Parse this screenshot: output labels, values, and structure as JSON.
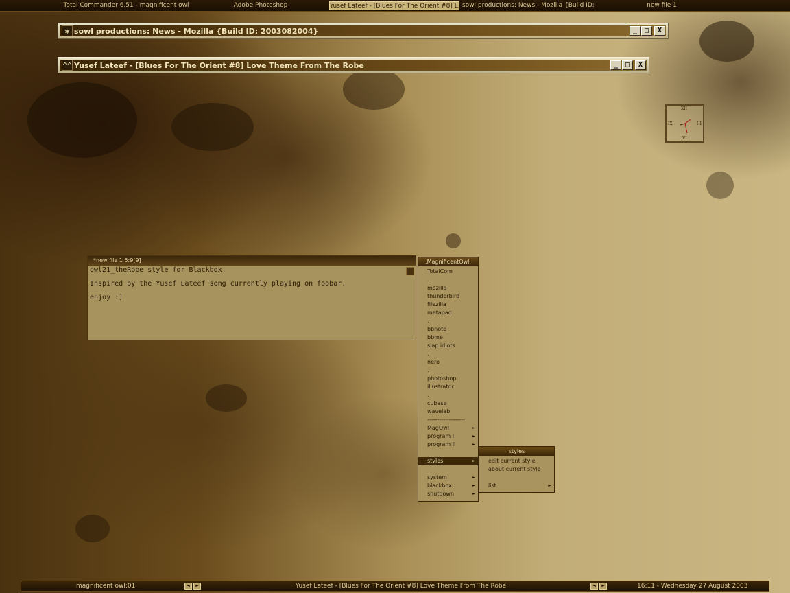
{
  "taskbar": {
    "tasks": [
      "Total Commander 6.51 - magnificent owl",
      "Adobe Photoshop",
      "Yusef Lateef - [Blues For The Orient #8] L...",
      "sowl productions: News - Mozilla {Build ID:...",
      "new file 1"
    ]
  },
  "windows": {
    "mozilla": {
      "title": "sowl productions: News - Mozilla {Build ID: 2003082004}",
      "icon": "mozilla-icon"
    },
    "foobar": {
      "title": "Yusef Lateef - [Blues For The Orient #8] Love Theme From The Robe",
      "icon": "foobar-icon"
    }
  },
  "window_buttons": {
    "minimize": "_",
    "maximize": "□",
    "close": "X"
  },
  "editor": {
    "title": "*new file 1  5:9[9]",
    "lines": [
      "owl21_theRobe style for Blackbox.",
      "Inspired by the Yusef Lateef song currently playing on foobar.",
      "enjoy :]"
    ]
  },
  "menu": {
    "title": ".MagnificentOwl.",
    "items": [
      {
        "label": "TotalCom",
        "arrow": false
      },
      {
        "label": ".",
        "arrow": false
      },
      {
        "label": "mozilla",
        "arrow": false
      },
      {
        "label": "thunderbird",
        "arrow": false
      },
      {
        "label": "filezilla",
        "arrow": false
      },
      {
        "label": "metapad",
        "arrow": false
      },
      {
        "label": ".",
        "arrow": false
      },
      {
        "label": "bbnote",
        "arrow": false
      },
      {
        "label": "bbme",
        "arrow": false
      },
      {
        "label": "slap idiots",
        "arrow": false
      },
      {
        "label": ".",
        "arrow": false
      },
      {
        "label": "nero",
        "arrow": false
      },
      {
        "label": ".",
        "arrow": false
      },
      {
        "label": "photoshop",
        "arrow": false
      },
      {
        "label": "illustrator",
        "arrow": false
      },
      {
        "label": ".",
        "arrow": false
      },
      {
        "label": "cubase",
        "arrow": false
      },
      {
        "label": "wavelab",
        "arrow": false
      },
      {
        "label": "-------------------",
        "arrow": false
      },
      {
        "label": "MagOwl",
        "arrow": true
      },
      {
        "label": "program I",
        "arrow": true
      },
      {
        "label": "program II",
        "arrow": true
      },
      {
        "label": "",
        "arrow": false
      },
      {
        "label": "styles",
        "arrow": true,
        "selected": true
      },
      {
        "label": "",
        "arrow": false
      },
      {
        "label": "system",
        "arrow": true
      },
      {
        "label": "blackbox",
        "arrow": true
      },
      {
        "label": "shutdown",
        "arrow": true
      }
    ],
    "arrow_glyph": "►"
  },
  "submenu": {
    "title": "styles",
    "items": [
      {
        "label": "edit current style",
        "arrow": false
      },
      {
        "label": "about current style",
        "arrow": false
      },
      {
        "label": "",
        "arrow": false
      },
      {
        "label": "list",
        "arrow": true
      }
    ]
  },
  "clock": {
    "numerals": [
      "XII",
      "III",
      "VI",
      "IX"
    ]
  },
  "bottombar": {
    "workspace": "magnificent owl:01",
    "now_playing": "Yusef Lateef - [Blues For The Orient #8] Love Theme From The Robe",
    "datetime": "16:11 - Wednesday 27 August 2003",
    "prev": "◄",
    "next": "►"
  },
  "colors": {
    "accent": "#3d2808",
    "text_light": "#e6d7a6",
    "menu_bg": "#a99460"
  }
}
